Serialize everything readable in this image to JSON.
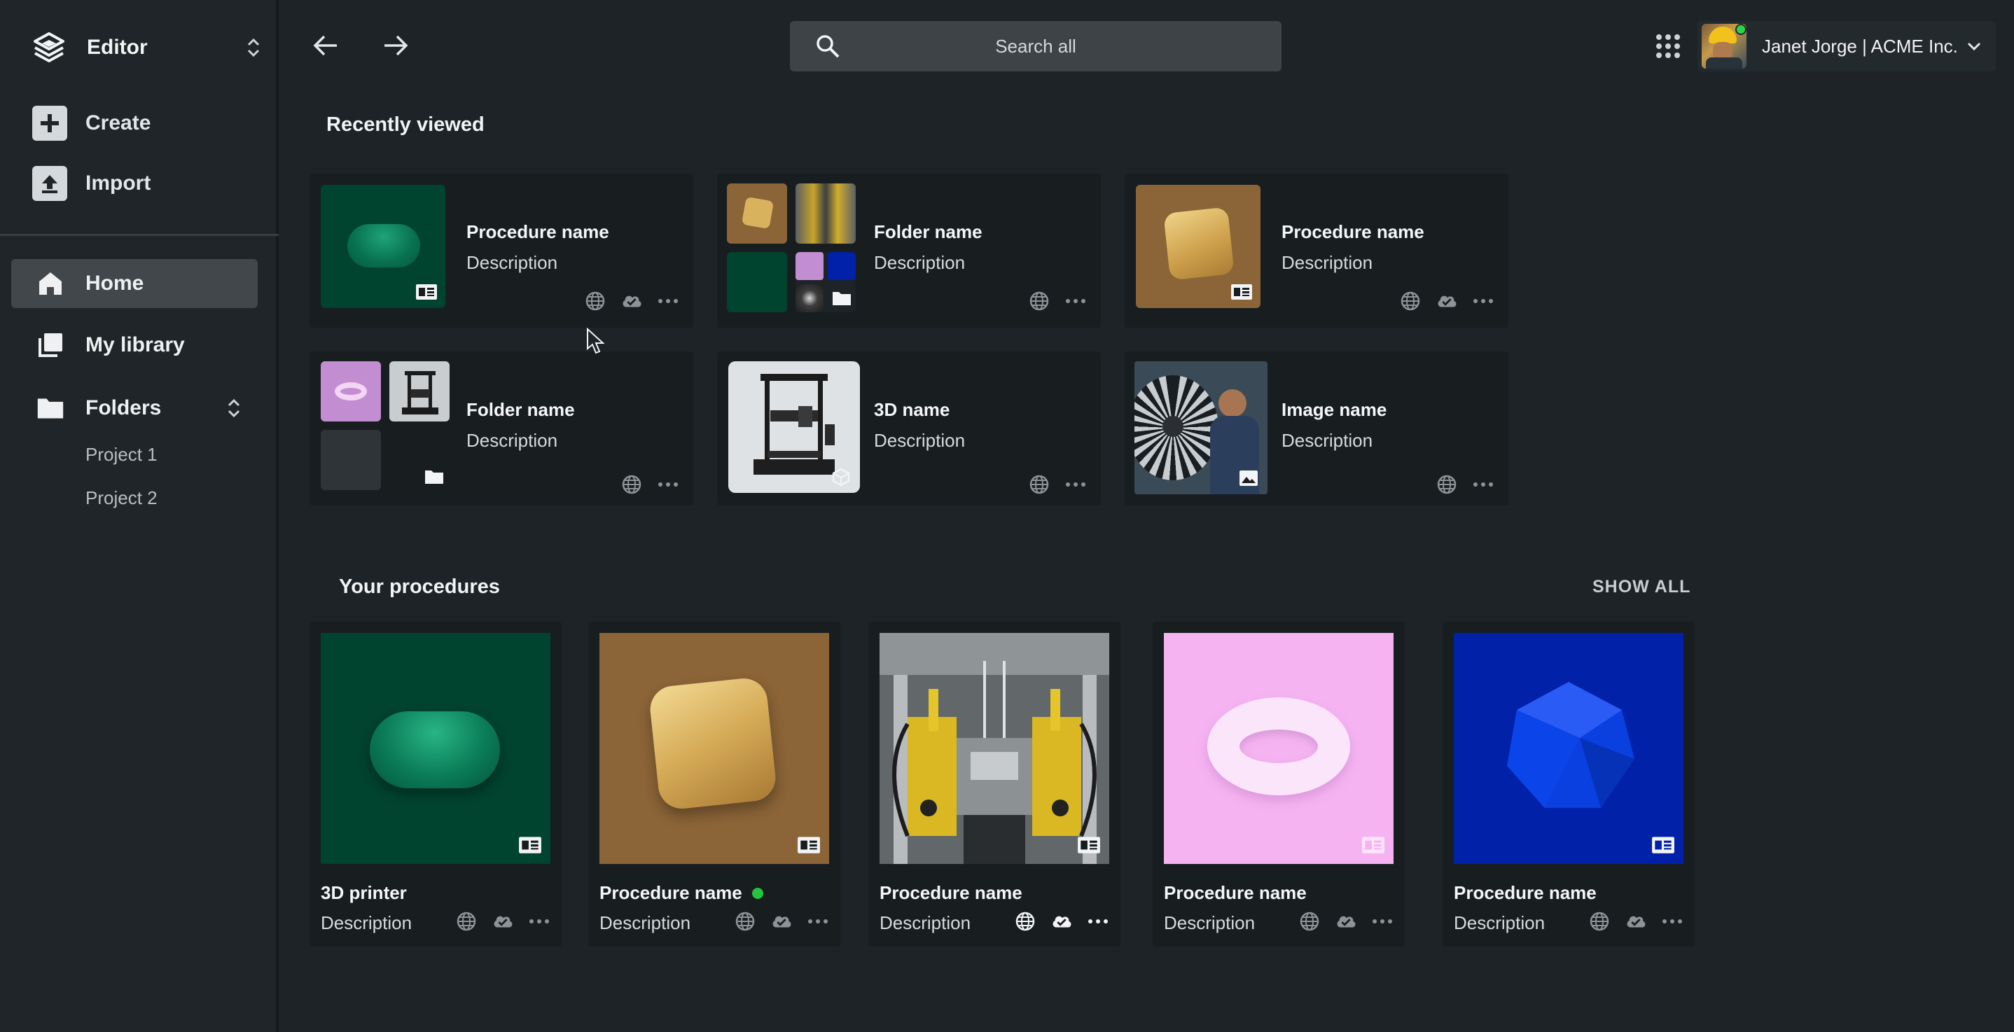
{
  "sidebar": {
    "app_title": "Editor",
    "create_label": "Create",
    "import_label": "Import",
    "nav": {
      "home": "Home",
      "library": "My library",
      "folders": "Folders"
    },
    "projects": [
      "Project 1",
      "Project 2"
    ]
  },
  "topbar": {
    "search_placeholder": "Search all",
    "user_name": "Janet Jorge |  ACME Inc."
  },
  "recent": {
    "title": "Recently viewed",
    "items": [
      {
        "title": "Procedure name",
        "description": "Description",
        "kind": "procedure"
      },
      {
        "title": "Folder name",
        "description": "Description",
        "kind": "folder"
      },
      {
        "title": "Procedure name",
        "description": "Description",
        "kind": "procedure"
      },
      {
        "title": "Folder name",
        "description": "Description",
        "kind": "folder"
      },
      {
        "title": "3D name",
        "description": "Description",
        "kind": "3d"
      },
      {
        "title": "Image name",
        "description": "Description",
        "kind": "image"
      }
    ]
  },
  "procedures": {
    "title": "Your procedures",
    "show_all": "SHOW ALL",
    "items": [
      {
        "title": "3D printer",
        "description": "Description",
        "color": "#00432f"
      },
      {
        "title": "Procedure name",
        "description": "Description",
        "color": "#8b6437"
      },
      {
        "title": "Procedure name",
        "description": "Description",
        "color": "#7a6c55"
      },
      {
        "title": "Procedure name",
        "description": "Description",
        "color": "#f5b3f2"
      },
      {
        "title": "Procedure name",
        "description": "Description",
        "color": "#0021a8"
      }
    ]
  },
  "colors": {
    "background": "#1d2326",
    "card": "#181d20",
    "active_nav": "#41474b",
    "online": "#2bd34a"
  }
}
